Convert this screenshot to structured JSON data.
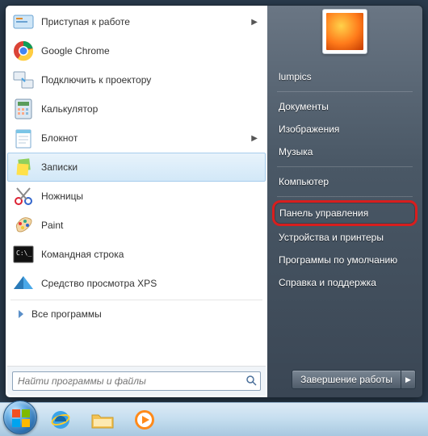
{
  "left": {
    "programs": [
      {
        "label": "Приступая к работе",
        "has_submenu": true
      },
      {
        "label": "Google Chrome"
      },
      {
        "label": "Подключить к проектору"
      },
      {
        "label": "Калькулятор"
      },
      {
        "label": "Блокнот",
        "has_submenu": true
      },
      {
        "label": "Записки",
        "selected": true
      },
      {
        "label": "Ножницы"
      },
      {
        "label": "Paint"
      },
      {
        "label": "Командная строка"
      },
      {
        "label": "Средство просмотра XPS"
      }
    ],
    "all_programs": "Все программы",
    "search_placeholder": "Найти программы и файлы"
  },
  "right": {
    "user": "lumpics",
    "group1": [
      "Документы",
      "Изображения",
      "Музыка"
    ],
    "group2": [
      "Компьютер"
    ],
    "group3": [
      "Панель управления",
      "Устройства и принтеры",
      "Программы по умолчанию",
      "Справка и поддержка"
    ],
    "highlighted": "Панель управления",
    "shutdown": "Завершение работы"
  }
}
